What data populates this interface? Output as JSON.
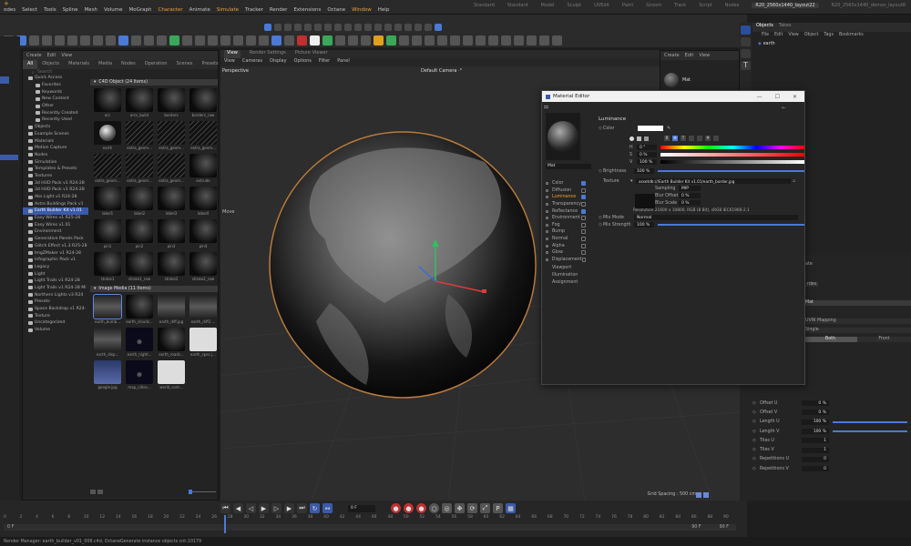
{
  "menubar": {
    "items": [
      "odes",
      "Select",
      "Tools",
      "Spline",
      "Mesh",
      "Volume",
      "MoGraph",
      "Character",
      "Animate",
      "Simulate",
      "Tracker",
      "Render",
      "Extensions",
      "Octane",
      "Window",
      "Help"
    ],
    "layouts": [
      "Standard",
      "Standard",
      "Model",
      "Sculpt",
      "UVEdit",
      "Paint",
      "Groom",
      "Track",
      "Script",
      "Nodes",
      "R20_2560x1440_layout22",
      "R20_2560x1440_demos_layout8"
    ],
    "active_layout": "R20_2560x1440_layout22"
  },
  "browser": {
    "header_items": [
      "Create",
      "Edit",
      "View"
    ],
    "tabs": [
      "All",
      "Objects",
      "Materials",
      "Media",
      "Nodes",
      "Operation",
      "Scenes",
      "Presets"
    ],
    "search_placeholder": "Search",
    "tree": [
      {
        "label": "Quick Access"
      },
      {
        "label": "Favorites"
      },
      {
        "label": "Keywords"
      },
      {
        "label": "New Content"
      },
      {
        "label": "Other"
      },
      {
        "label": "Recently Created"
      },
      {
        "label": "Recently Used"
      },
      {
        "label": "Objects"
      },
      {
        "label": "Example Scenes"
      },
      {
        "label": "Materials"
      },
      {
        "label": "Motion Capture"
      },
      {
        "label": "Nodes"
      },
      {
        "label": "Simulation"
      },
      {
        "label": "Templates & Presets"
      },
      {
        "label": "Textures"
      },
      {
        "label": "3d HUD Pack v1 R24-28"
      },
      {
        "label": "3d HUD Pack v1 R24-28"
      },
      {
        "label": "Abs Light v1 R24-28"
      },
      {
        "label": "Astro Buildings Pack v1"
      },
      {
        "label": "Earth Builder Kit v1.01",
        "selected": true
      },
      {
        "label": "Easy Wires v1 R25-28"
      },
      {
        "label": "Easy Wires v1.01"
      },
      {
        "label": "Environment"
      },
      {
        "label": "Generative Panels Pack"
      },
      {
        "label": "Glitch Effect v1.3 R25-28"
      },
      {
        "label": "ImgZMaker v1 R24-28"
      },
      {
        "label": "Infographic Pack v1"
      },
      {
        "label": "Legacy"
      },
      {
        "label": "Light"
      },
      {
        "label": "Light Trails v1 R24-28"
      },
      {
        "label": "Light Trails v1 R24-28 Mi"
      },
      {
        "label": "Northern Lights v3 R24"
      },
      {
        "label": "Presets"
      },
      {
        "label": "Space Backdrop v1 R24-"
      },
      {
        "label": "Texture"
      },
      {
        "label": "Uncategorized"
      },
      {
        "label": "Volume"
      }
    ],
    "c4d_section": "C4D Object (24 Items)",
    "c4d_items": [
      "arc",
      "arcs_build",
      "borders",
      "borders_raw",
      "earth",
      "extra_geom...",
      "extra_geom...",
      "extra_geom...",
      "extra_geom...",
      "extra_geom...",
      "extra_geom...",
      "extrude",
      "label1",
      "label2",
      "label3",
      "label4",
      "pin1",
      "pin2",
      "pin3",
      "pin4",
      "stroke1",
      "stroke1_raw",
      "stroke2",
      "stroke2_raw"
    ],
    "image_section": "Image Media (11 Items)",
    "image_items": [
      "earth_bumb...",
      "earth_clouds...",
      "earth_diff.jpg",
      "earth_diff2....",
      "earth_disp...",
      "earth_night...",
      "earth_roads...",
      "earth_spec.j...",
      "google.jpg",
      "map_cities...",
      "world_cont..."
    ]
  },
  "viewport": {
    "tabs": [
      "View",
      "Render Settings",
      "Picture Viewer"
    ],
    "menu": [
      "View",
      "Cameras",
      "Display",
      "Options",
      "Filter",
      "Panel"
    ],
    "label": "Perspective",
    "camera": "Default Camera ·°",
    "move_label": "Move",
    "grid_spacing": "Grid Spacing : 500 cm"
  },
  "material_panel": {
    "menu": [
      "Create",
      "Edit",
      "View"
    ],
    "mat_name": "Mat"
  },
  "mateditor": {
    "title": "Material Editor",
    "mat_name": "Mat",
    "channels": [
      {
        "label": "Color",
        "checked": true
      },
      {
        "label": "Diffusion",
        "checked": false
      },
      {
        "label": "Luminance",
        "checked": true,
        "active": true
      },
      {
        "label": "Transparency",
        "checked": false
      },
      {
        "label": "Reflectance",
        "checked": true
      },
      {
        "label": "Environment",
        "checked": false
      },
      {
        "label": "Fog",
        "checked": false
      },
      {
        "label": "Bump",
        "checked": false
      },
      {
        "label": "Normal",
        "checked": false
      },
      {
        "label": "Alpha",
        "checked": false
      },
      {
        "label": "Glow",
        "checked": false
      },
      {
        "label": "Displacement",
        "checked": false
      },
      {
        "label": "Viewport",
        "checked": null
      },
      {
        "label": "Illumination",
        "checked": null
      },
      {
        "label": "Assignment",
        "checked": null
      }
    ],
    "section": "Luminance",
    "color_label": "Color",
    "h_label": "H",
    "h_value": "0 °",
    "s_label": "S",
    "s_value": "0 %",
    "v_label": "V",
    "v_value": "100 %",
    "brightness_label": "Brightness",
    "brightness_value": "100 %",
    "texture_label": "Texture",
    "texture_path": "assetdb:///Earth Builder Kit v1.01/earth_border.jpg",
    "sampling_label": "Sampling",
    "sampling_value": "MIP",
    "blur_offset_label": "Blur Offset",
    "blur_offset_value": "0 %",
    "blur_scale_label": "Blur Scale",
    "blur_scale_value": "0 %",
    "resolution": "Resolution 21600 x 10800, RGB (8 Bit), sRGB IEC61966-2.1",
    "mix_mode_label": "Mix Mode",
    "mix_mode_value": "Normal",
    "mix_strength_label": "Mix Strength",
    "mix_strength_value": "100 %"
  },
  "objects_panel": {
    "tabs": [
      "Objects",
      "Takes"
    ],
    "menu": [
      "File",
      "Edit",
      "View",
      "Object",
      "Tags",
      "Bookmarks"
    ],
    "item": "earth"
  },
  "attributes": {
    "state_label": "ate",
    "tag_label": "rdes",
    "material_label": "Mat",
    "projection_value": "UVW Mapping",
    "single_label": "Single",
    "side_front_label": "Both",
    "side_front2_label": "Front",
    "rows": [
      {
        "label": "Offset U",
        "value": "0 %"
      },
      {
        "label": "Offset V",
        "value": "0 %"
      },
      {
        "label": "Length U",
        "value": "100 %"
      },
      {
        "label": "Length V",
        "value": "100 %"
      },
      {
        "label": "Tiles U",
        "value": "1"
      },
      {
        "label": "Tiles V",
        "value": "1"
      },
      {
        "label": "Repetitions U",
        "value": "0"
      },
      {
        "label": "Repetitions V",
        "value": "0"
      }
    ]
  },
  "timeline": {
    "frame_field": "0 F",
    "ticks": [
      "0",
      "2",
      "4",
      "6",
      "8",
      "10",
      "12",
      "14",
      "16",
      "18",
      "20",
      "22",
      "24",
      "26",
      "28",
      "30",
      "32",
      "34",
      "36",
      "38",
      "40",
      "42",
      "44",
      "46",
      "48",
      "50",
      "52",
      "54",
      "56",
      "58",
      "60",
      "62",
      "64",
      "66",
      "68",
      "70",
      "72",
      "74",
      "76",
      "78",
      "80",
      "82",
      "84",
      "86",
      "88",
      "90"
    ],
    "start": "0 F",
    "end": "90 F",
    "end2": "90 F"
  },
  "status": {
    "text": "Render Manager: earth_builder_v01_008.c4d, OctaneGenerate instance objects cnt:10179"
  },
  "colors": {
    "accent": "#3b5aa8",
    "selection": "#4a7ad6",
    "luminance_highlight": "#f0a030"
  }
}
